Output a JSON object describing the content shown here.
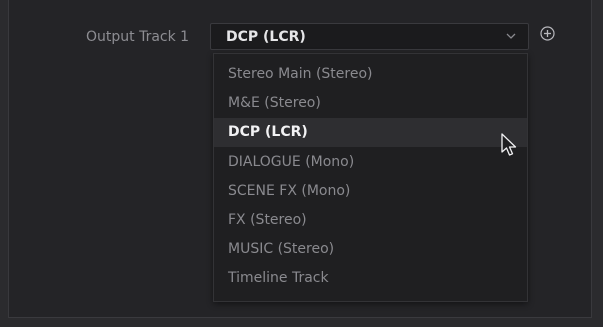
{
  "field": {
    "label": "Output Track 1",
    "selected_value": "DCP (LCR)",
    "chevron_icon": "chevron-down-icon",
    "add_icon": "add-circle-icon"
  },
  "menu": {
    "items": [
      {
        "label": "Stereo Main (Stereo)",
        "selected": false
      },
      {
        "label": "M&E (Stereo)",
        "selected": false
      },
      {
        "label": "DCP (LCR)",
        "selected": true
      },
      {
        "label": "DIALOGUE (Mono)",
        "selected": false
      },
      {
        "label": "SCENE FX (Mono)",
        "selected": false
      },
      {
        "label": "FX (Stereo)",
        "selected": false
      },
      {
        "label": "MUSIC (Stereo)",
        "selected": false
      },
      {
        "label": "Timeline Track",
        "selected": false
      }
    ]
  },
  "cursor": {
    "icon": "mouse-pointer-icon"
  }
}
